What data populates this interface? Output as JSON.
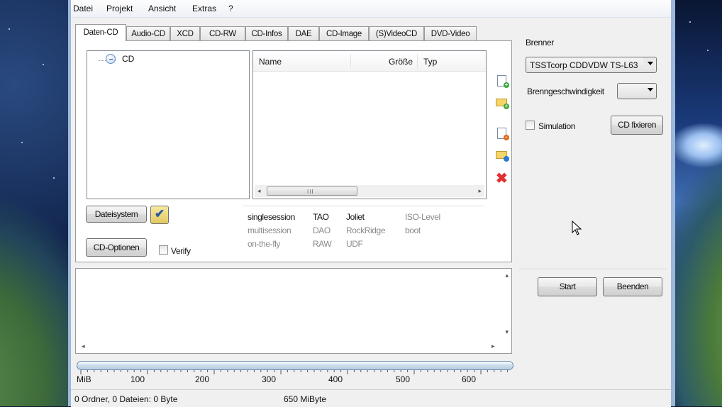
{
  "menu": [
    "Datei",
    "Projekt",
    "Ansicht",
    "Extras",
    "?"
  ],
  "tabs": [
    "Daten-CD",
    "Audio-CD",
    "XCD",
    "CD-RW",
    "CD-Infos",
    "DAE",
    "CD-Image",
    "(S)VideoCD",
    "DVD-Video"
  ],
  "active_tab": "Daten-CD",
  "tree": {
    "root_label": "CD"
  },
  "file_list": {
    "columns": [
      "Name",
      "Größe",
      "Typ"
    ],
    "scroll_grip": "III"
  },
  "buttons": {
    "filesystem": "Dateisystem",
    "cd_options": "CD-Optionen",
    "cd_fix": "CD fixieren",
    "start": "Start",
    "quit": "Beenden"
  },
  "verify_label": "Verify",
  "options": {
    "row1": [
      "singlesession",
      "TAO",
      "Joliet",
      "ISO-Level"
    ],
    "row2": [
      "multisession",
      "DAO",
      "RockRidge",
      "boot"
    ],
    "row3": [
      "on-the-fly",
      "RAW",
      "UDF"
    ]
  },
  "burner": {
    "label": "Brenner",
    "device": "TSSTcorp CDDVDW TS-L63",
    "speed_label": "Brenngeschwindigkeit",
    "speed_value": "",
    "simulation_label": "Simulation",
    "simulation_checked": false
  },
  "scale": {
    "labels": [
      "MiB",
      "100",
      "200",
      "300",
      "400",
      "500",
      "600"
    ]
  },
  "status": {
    "counts": "0 Ordner, 0 Dateien: 0 Byte",
    "capacity": "650 MiByte"
  },
  "colors": {
    "window_frame": "#9db8d9",
    "scale_fill": "#c9dcea",
    "delete_icon": "#e03030"
  }
}
